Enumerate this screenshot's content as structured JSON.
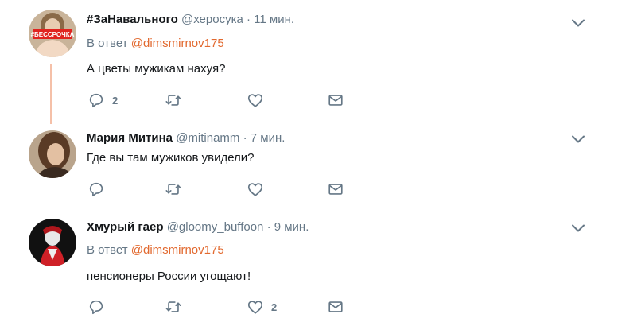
{
  "tweets": [
    {
      "name": "#ЗаНавального",
      "handle": "@херосука",
      "sep": "·",
      "time": "11 мин.",
      "reply_prefix": "В ответ",
      "reply_to": "@dimsmirnov175",
      "text": "А цветы мужикам нахуя?",
      "replies": "2",
      "retweets": "",
      "likes": "",
      "avatar_badge": "#БЕССРОЧКА"
    },
    {
      "name": "Мария Митина",
      "handle": "@mitinamm",
      "sep": "·",
      "time": "7 мин.",
      "text": "Где вы там мужиков увидели?",
      "replies": "",
      "retweets": "",
      "likes": ""
    },
    {
      "name": "Хмурый гаер",
      "handle": "@gloomy_buffoon",
      "sep": "·",
      "time": "9 мин.",
      "reply_prefix": "В ответ",
      "reply_to": "@dimsmirnov175",
      "text": "пенсионеры России угощают!",
      "replies": "",
      "retweets": "",
      "likes": "2"
    }
  ],
  "icons": {
    "reply": "reply-icon",
    "retweet": "retweet-icon",
    "like": "heart-icon",
    "dm": "envelope-icon",
    "more": "chevron-down-icon"
  },
  "colors": {
    "text": "#14171a",
    "secondary": "#657786",
    "link": "#e2692f",
    "thread_line": "#f5c0a8",
    "divider": "#e6ecf0"
  }
}
